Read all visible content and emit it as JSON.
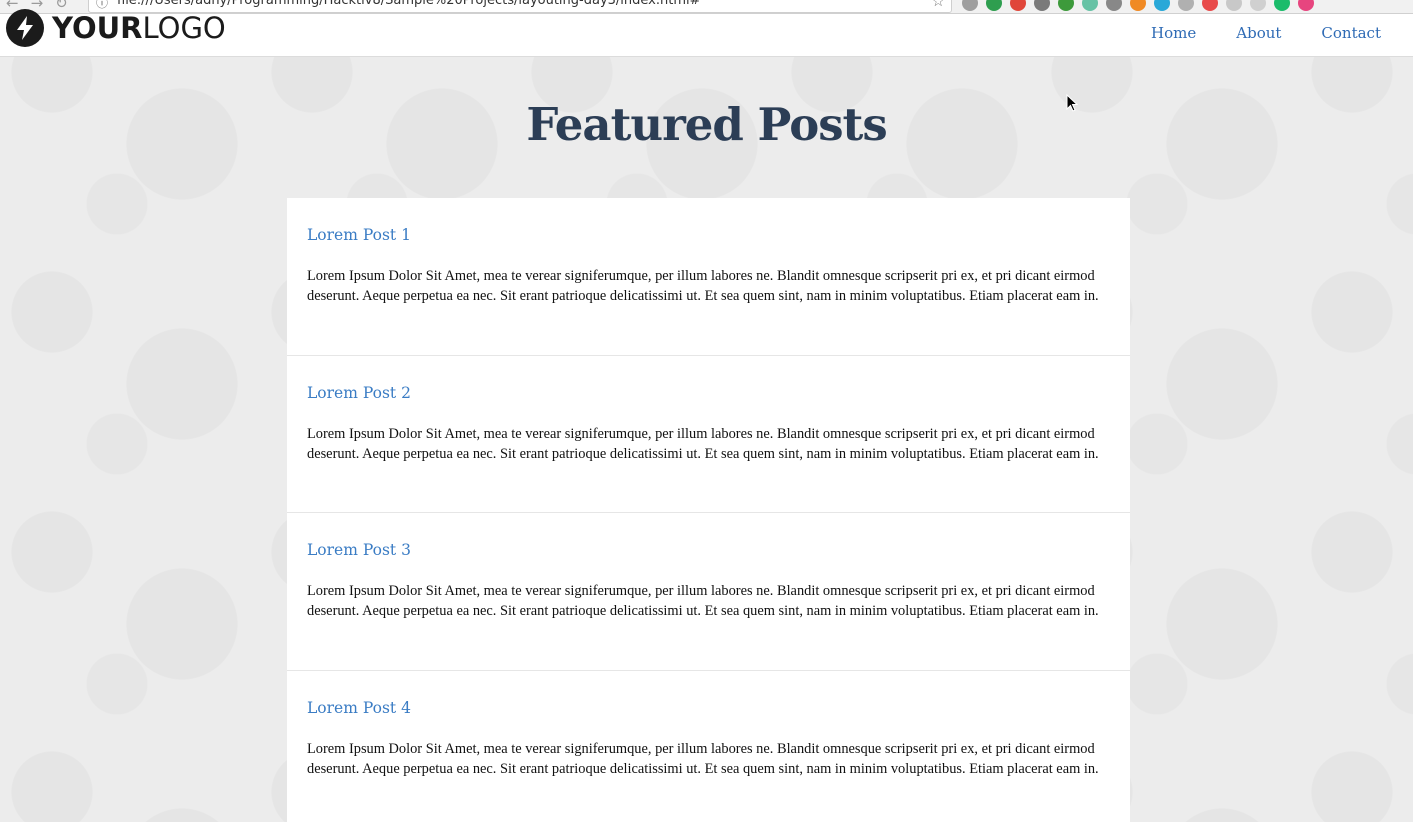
{
  "browser": {
    "url": "file:///Users/adny/Programming/Hacktiv8/Sample%20Projects/layouting-day3/index.html#",
    "extension_colors": [
      "#9e9e9e",
      "#2e9e4f",
      "#e0463a",
      "#7a7a7a",
      "#3d9a3b",
      "#66c2a5",
      "#888888",
      "#f08a24",
      "#29a8d8",
      "#b0b0b0",
      "#e84a4a",
      "#c8c8c8",
      "#d0d0d0",
      "#1bbc6b",
      "#e7457f"
    ]
  },
  "header": {
    "logo_bold": "YOUR",
    "logo_light": "LOGO",
    "nav": [
      {
        "label": "Home"
      },
      {
        "label": "About"
      },
      {
        "label": "Contact"
      }
    ]
  },
  "page": {
    "title": "Featured Posts"
  },
  "posts": [
    {
      "title": "Lorem Post 1",
      "body": "Lorem Ipsum Dolor Sit Amet, mea te verear signiferumque, per illum labores ne. Blandit omnesque scripserit pri ex, et pri dicant eirmod deserunt. Aeque perpetua ea nec. Sit erant patrioque delicatissimi ut. Et sea quem sint, nam in minim voluptatibus. Etiam placerat eam in."
    },
    {
      "title": "Lorem Post 2",
      "body": "Lorem Ipsum Dolor Sit Amet, mea te verear signiferumque, per illum labores ne. Blandit omnesque scripserit pri ex, et pri dicant eirmod deserunt. Aeque perpetua ea nec. Sit erant patrioque delicatissimi ut. Et sea quem sint, nam in minim voluptatibus. Etiam placerat eam in."
    },
    {
      "title": "Lorem Post 3",
      "body": "Lorem Ipsum Dolor Sit Amet, mea te verear signiferumque, per illum labores ne. Blandit omnesque scripserit pri ex, et pri dicant eirmod deserunt. Aeque perpetua ea nec. Sit erant patrioque delicatissimi ut. Et sea quem sint, nam in minim voluptatibus. Etiam placerat eam in."
    },
    {
      "title": "Lorem Post 4",
      "body": "Lorem Ipsum Dolor Sit Amet, mea te verear signiferumque, per illum labores ne. Blandit omnesque scripserit pri ex, et pri dicant eirmod deserunt. Aeque perpetua ea nec. Sit erant patrioque delicatissimi ut. Et sea quem sint, nam in minim voluptatibus. Etiam placerat eam in."
    }
  ],
  "colors": {
    "link": "#3a7cc4",
    "title": "#2c3e56",
    "nav": "#2f6bb5"
  }
}
